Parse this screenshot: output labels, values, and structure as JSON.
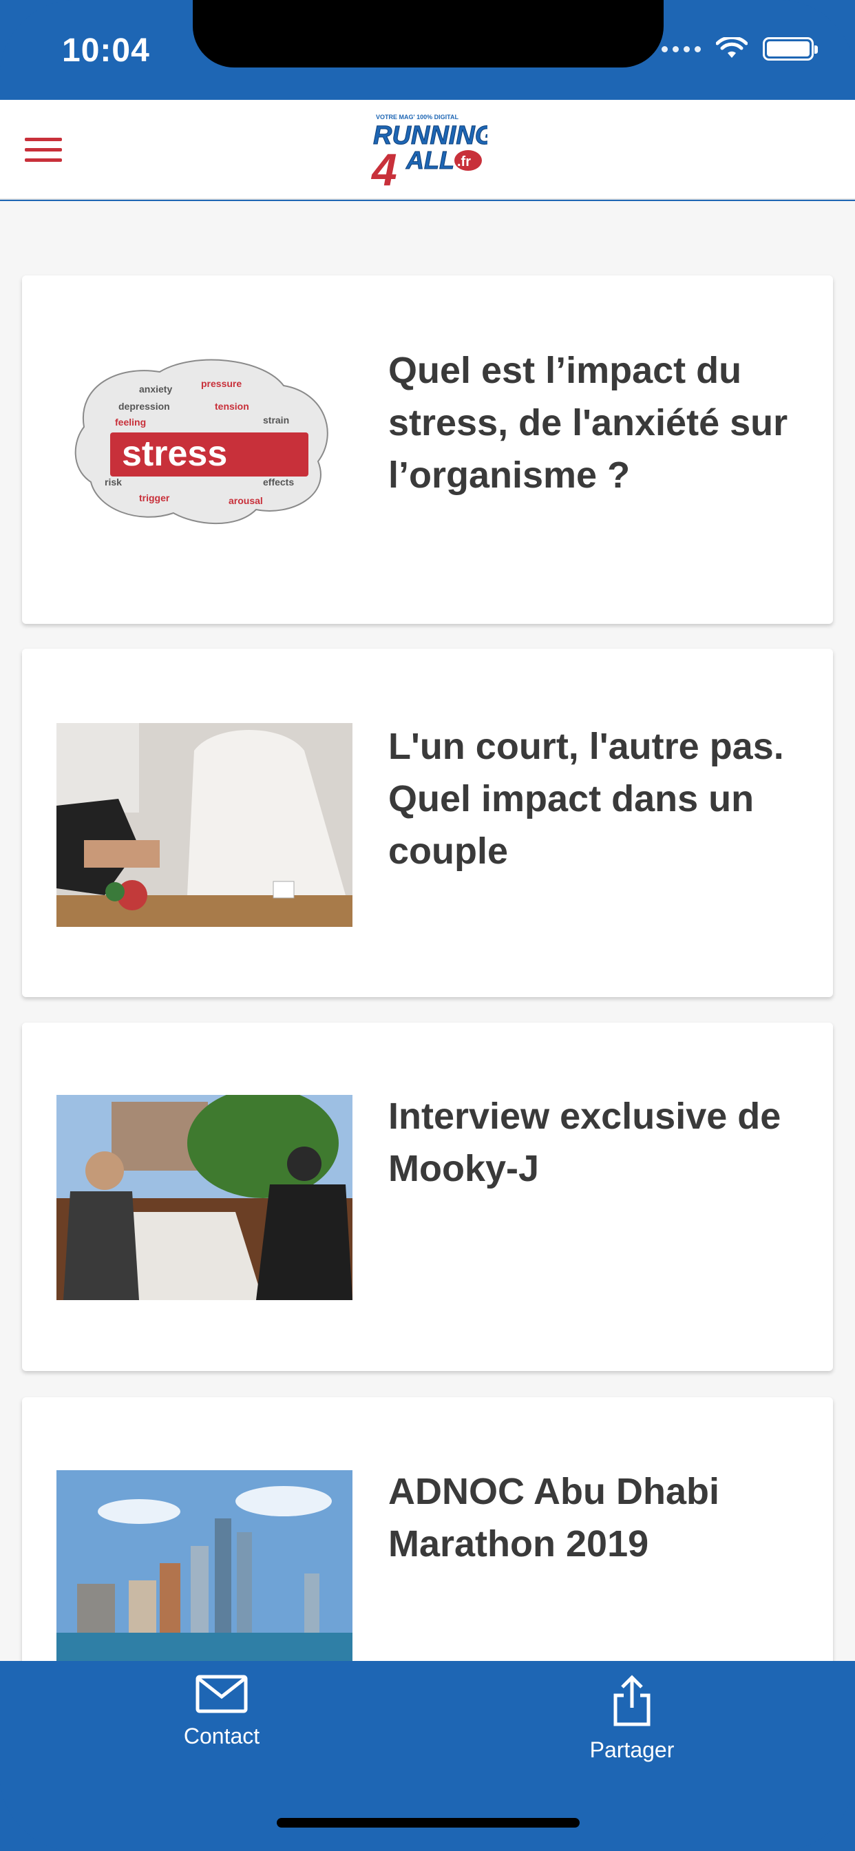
{
  "status_bar": {
    "time": "10:04"
  },
  "navbar": {
    "menu_icon": "hamburger-icon",
    "logo": {
      "line1": "RUNNING",
      "number": "4",
      "line2": "ALL",
      "suffix": ".fr",
      "tagline": "VOTRE MAG' 100% DIGITAL"
    }
  },
  "articles": [
    {
      "title": "Quel est l’impact du stress, de l'anxiété sur l’organisme ?",
      "image": "stress-word-cloud-brain",
      "image_word": "stress"
    },
    {
      "title": "L'un court, l'autre pas. Quel impact dans un couple",
      "image": "runner-and-bride-photo"
    },
    {
      "title": "Interview exclusive de Mooky-J",
      "image": "interview-terrace-photo"
    },
    {
      "title": "ADNOC Abu Dhabi Marathon 2019",
      "image": "abu-dhabi-skyline-photo"
    }
  ],
  "tabbar": {
    "contact_label": "Contact",
    "contact_icon": "envelope-icon",
    "share_label": "Partager",
    "share_icon": "share-icon"
  },
  "colors": {
    "primary": "#1e66b4",
    "accent": "#c8303a",
    "text": "#3a3a3a"
  }
}
